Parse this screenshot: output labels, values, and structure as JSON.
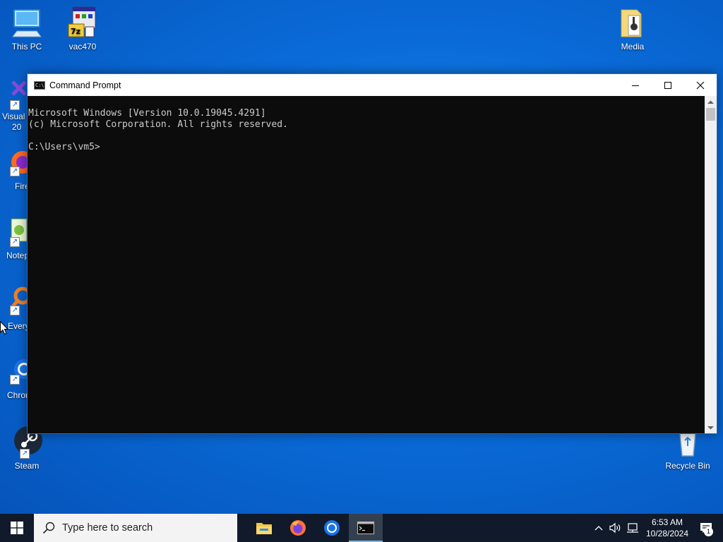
{
  "desktop_icons": {
    "this_pc": "This PC",
    "vac470": "vac470",
    "media": "Media",
    "visual_studio": [
      "Visual",
      "20"
    ],
    "firefox": "Fire",
    "notepad": "Notep",
    "everything": "Every",
    "chrome": "Chron",
    "steam": "Steam",
    "recycle_bin": "Recycle Bin"
  },
  "cmd": {
    "title": "Command Prompt",
    "lines": [
      "Microsoft Windows [Version 10.0.19045.4291]",
      "(c) Microsoft Corporation. All rights reserved.",
      "",
      "C:\\Users\\vm5>"
    ]
  },
  "taskbar": {
    "search_placeholder": "Type here to search",
    "apps": [
      "file-explorer-icon",
      "firefox-icon",
      "chrome-icon",
      "command-prompt-icon"
    ],
    "active_app": "command-prompt-icon",
    "clock_time": "6:53 AM",
    "clock_date": "10/28/2024",
    "notification_count": "1"
  },
  "colors": {
    "desktop_blue": "#0a6bd8",
    "taskbar": "#101a2a",
    "console_bg": "#0c0c0c",
    "console_text": "#cccccc"
  }
}
